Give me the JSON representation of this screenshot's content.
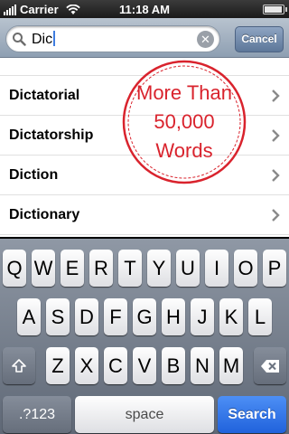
{
  "status_bar": {
    "carrier": "Carrier",
    "time": "11:18 AM",
    "battery_icon": "battery-full-icon",
    "wifi_icon": "wifi-icon",
    "signal_icon": "signal-bars-icon"
  },
  "search": {
    "value": "Dic",
    "clear_icon": "clear-icon",
    "cancel_label": "Cancel"
  },
  "results": [
    {
      "label": "Dictatorial"
    },
    {
      "label": "Dictatorship"
    },
    {
      "label": "Diction"
    },
    {
      "label": "Dictionary"
    }
  ],
  "stamp": {
    "line1": "More Than",
    "line2": "50,000",
    "line3": "Words",
    "color": "#d9232d"
  },
  "keyboard": {
    "row1": [
      "Q",
      "W",
      "E",
      "R",
      "T",
      "Y",
      "U",
      "I",
      "O",
      "P"
    ],
    "row2": [
      "A",
      "S",
      "D",
      "F",
      "G",
      "H",
      "J",
      "K",
      "L"
    ],
    "row3": [
      "Z",
      "X",
      "C",
      "V",
      "B",
      "N",
      "M"
    ],
    "numbers_label": ".?123",
    "space_label": "space",
    "search_label": "Search",
    "shift_icon": "shift-icon",
    "backspace_icon": "backspace-icon",
    "accent_color": "#2f74e8"
  }
}
